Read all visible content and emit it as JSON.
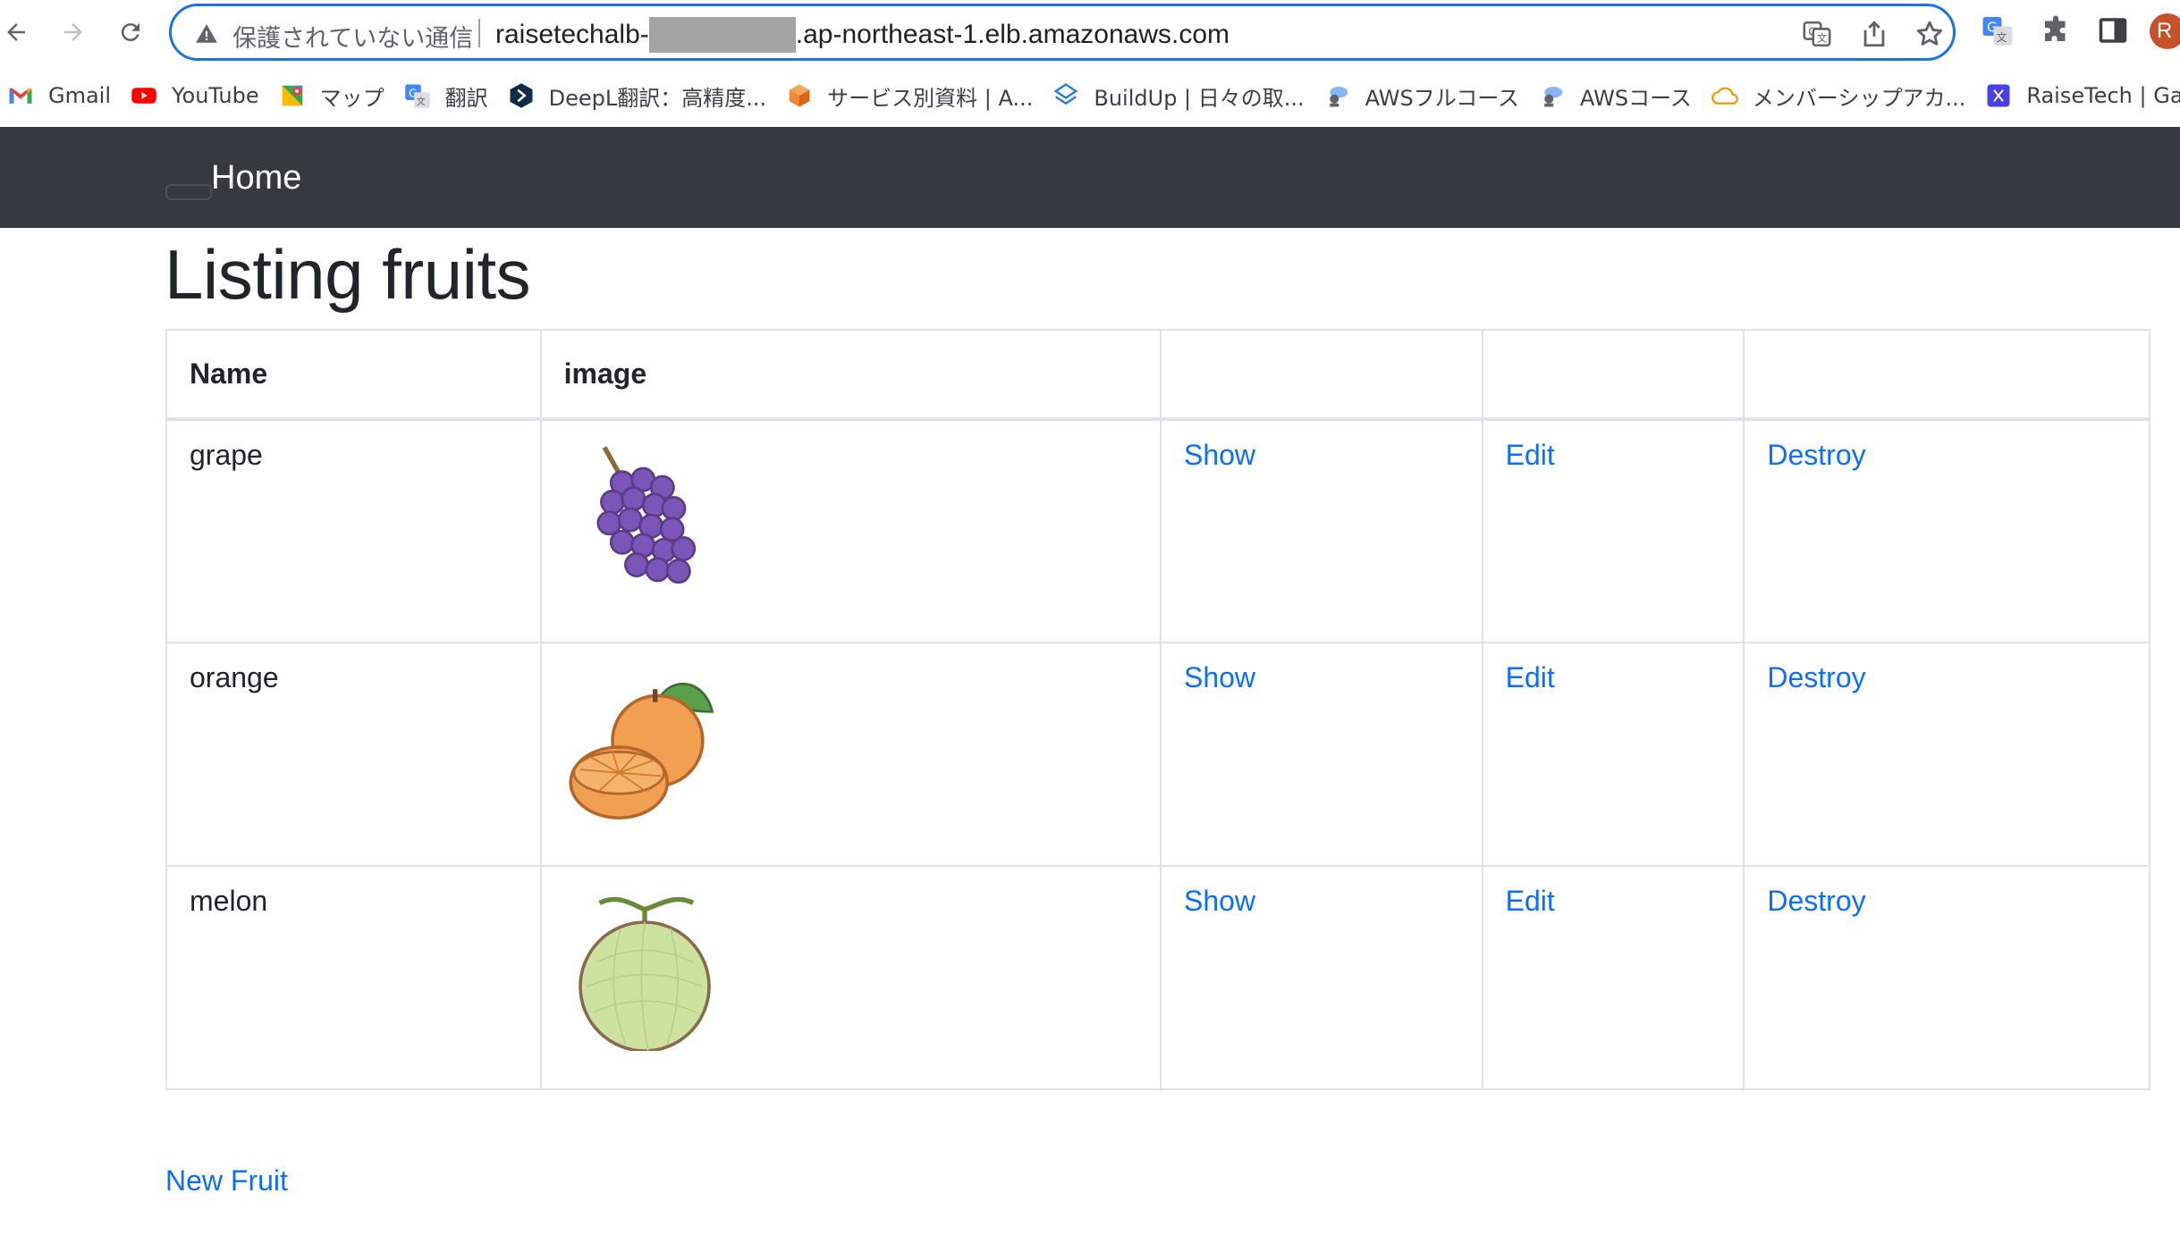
{
  "browser": {
    "security_label": "保護されていない通信",
    "url_prefix": "raisetechalb-",
    "url_suffix": ".ap-northeast-1.elb.amazonaws.com",
    "profile_initial": "R",
    "bookmarks": [
      {
        "label": "Gmail",
        "icon": "gmail-icon"
      },
      {
        "label": "YouTube",
        "icon": "youtube-icon"
      },
      {
        "label": "マップ",
        "icon": "maps-icon"
      },
      {
        "label": "翻訳",
        "icon": "translate-icon"
      },
      {
        "label": "DeepL翻訳：高精度...",
        "icon": "deepl-icon"
      },
      {
        "label": "サービス別資料 | A...",
        "icon": "aws-cube-icon"
      },
      {
        "label": "BuildUp | 日々の取...",
        "icon": "buildup-icon"
      },
      {
        "label": "AWSフルコース",
        "icon": "aws-course-icon"
      },
      {
        "label": "AWSコース",
        "icon": "aws-course-icon"
      },
      {
        "label": "メンバーシップアカ...",
        "icon": "cloud-icon"
      },
      {
        "label": "RaiseTech | Ga",
        "icon": "raisetech-icon"
      }
    ]
  },
  "navbar": {
    "brand": "Home"
  },
  "page": {
    "title": "Listing fruits",
    "new_link": "New Fruit"
  },
  "table": {
    "headers": [
      "Name",
      "image",
      "",
      "",
      ""
    ],
    "rows": [
      {
        "name": "grape",
        "image": "grape-image",
        "show": "Show",
        "edit": "Edit",
        "destroy": "Destroy"
      },
      {
        "name": "orange",
        "image": "orange-image",
        "show": "Show",
        "edit": "Edit",
        "destroy": "Destroy"
      },
      {
        "name": "melon",
        "image": "melon-image",
        "show": "Show",
        "edit": "Edit",
        "destroy": "Destroy"
      }
    ]
  },
  "colors": {
    "navbar_bg": "#343a40",
    "link": "#0d6efd",
    "omnibox_border": "#1a73e8"
  }
}
